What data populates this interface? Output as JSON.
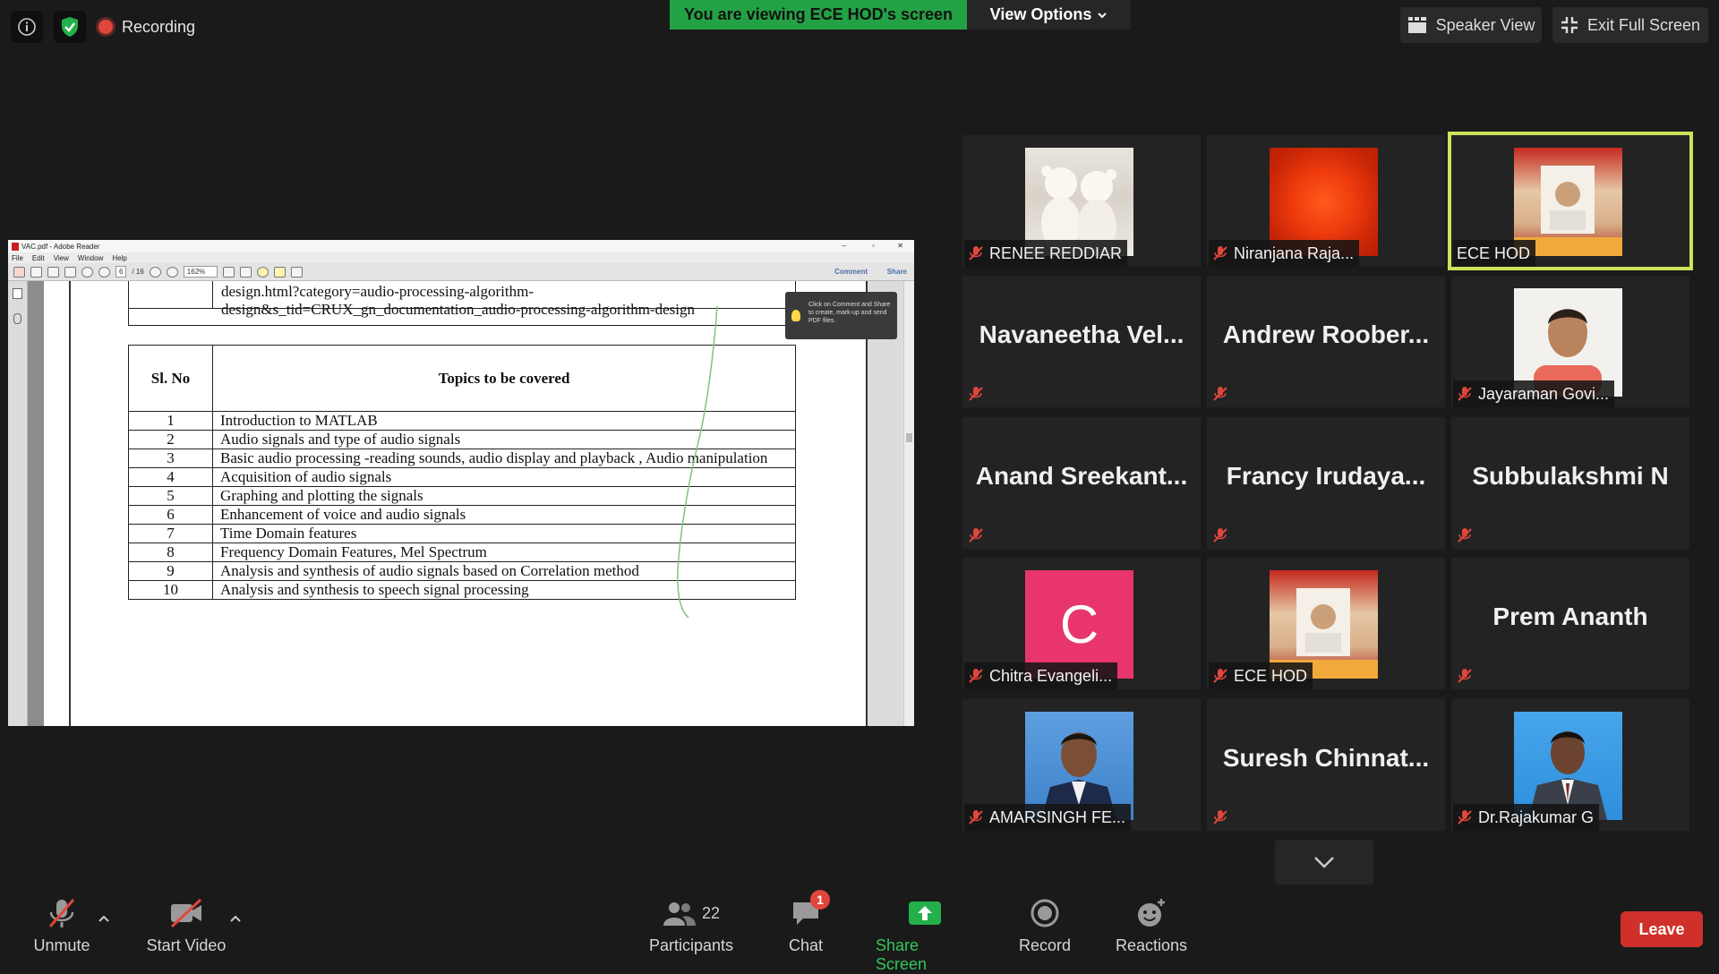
{
  "top": {
    "recording_label": "Recording",
    "viewing_banner": "You are viewing ECE HOD's screen",
    "view_options_label": "View Options",
    "speaker_view_label": "Speaker View",
    "exit_full_label": "Exit Full Screen"
  },
  "shared_screen": {
    "window_title": "VAC.pdf - Adobe Reader",
    "menu": [
      "File",
      "Edit",
      "View",
      "Window",
      "Help"
    ],
    "page_current": "6",
    "page_total": "/ 16",
    "zoom": "162%",
    "comment_label": "Comment",
    "share_label": "Share",
    "tooltip": "Click on Comment and Share to create, mark-up and send PDF files.",
    "link_line1": "design.html?category=audio-processing-algorithm-",
    "link_line2": "design&s_tid=CRUX_gn_documentation_audio-processing-algorithm-design",
    "table": {
      "headers": [
        "Sl. No",
        "Topics to be covered"
      ],
      "rows": [
        {
          "no": "1",
          "topic": "Introduction to MATLAB"
        },
        {
          "no": "2",
          "topic": "Audio signals and type of audio signals"
        },
        {
          "no": "3",
          "topic": "Basic audio processing -reading sounds, audio display and playback , Audio manipulation"
        },
        {
          "no": "4",
          "topic": "Acquisition of audio signals"
        },
        {
          "no": "5",
          "topic": "Graphing and plotting the signals"
        },
        {
          "no": "6",
          "topic": "Enhancement of voice and audio signals"
        },
        {
          "no": "7",
          "topic": "Time Domain features"
        },
        {
          "no": "8",
          "topic": "Frequency Domain Features, Mel Spectrum"
        },
        {
          "no": "9",
          "topic": "Analysis and synthesis of audio signals based on Correlation method"
        },
        {
          "no": "10",
          "topic": "Analysis and synthesis to speech signal processing"
        }
      ]
    }
  },
  "participants": {
    "t1": {
      "label": "RENEE REDDIAR"
    },
    "t2": {
      "label": "Niranjana Raja..."
    },
    "t3": {
      "label": "ECE HOD"
    },
    "t4": {
      "big": "Navaneetha  Vel..."
    },
    "t5": {
      "big": "Andrew  Roober..."
    },
    "t6": {
      "label": "Jayaraman Govi..."
    },
    "t7": {
      "big": "Anand  Sreekant..."
    },
    "t8": {
      "big": "Francy  Irudaya..."
    },
    "t9": {
      "big": "Subbulakshmi N"
    },
    "t10": {
      "label": "Chitra Evangeli...",
      "initial": "C"
    },
    "t11": {
      "label": "ECE HOD"
    },
    "t12": {
      "big": "Prem Ananth"
    },
    "t13": {
      "label": "AMARSINGH FE..."
    },
    "t14": {
      "big": "Suresh  Chinnat..."
    },
    "t15": {
      "label": "Dr.Rajakumar G"
    }
  },
  "toolbar": {
    "unmute": "Unmute",
    "start_video": "Start Video",
    "participants": "Participants",
    "participants_count": "22",
    "chat": "Chat",
    "chat_badge": "1",
    "share_screen": "Share Screen",
    "record": "Record",
    "reactions": "Reactions",
    "leave": "Leave"
  },
  "colors": {
    "accent_green": "#23a245",
    "active_speaker_border": "#cde35a",
    "leave_red": "#d0302a",
    "mute_red": "#e0463c"
  }
}
